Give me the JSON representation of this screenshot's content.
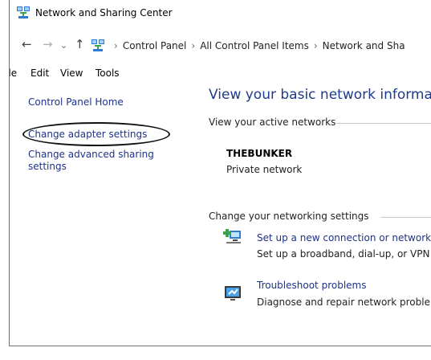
{
  "window": {
    "title": "Network and Sharing Center",
    "icon": "network-sharing-icon"
  },
  "navbar": {
    "back": "←",
    "forward": "→",
    "recent": "⌄",
    "up": "↑",
    "breadcrumb": [
      "Control Panel",
      "All Control Panel Items",
      "Network and Sha"
    ],
    "separator": "›"
  },
  "menubar": {
    "items": [
      "File",
      "Edit",
      "View",
      "Tools"
    ]
  },
  "sidebar": {
    "home": "Control Panel Home",
    "adapter": "Change adapter settings",
    "advanced": "Change advanced sharing settings"
  },
  "main": {
    "heading": "View your basic network informatio",
    "active_label": "View your active networks",
    "network_name": "THEBUNKER",
    "network_type": "Private network",
    "change_label": "Change your networking settings",
    "tasks": [
      {
        "link": "Set up a new connection or network",
        "desc": "Set up a broadband, dial-up, or VPN c",
        "icon": "new-connection-icon"
      },
      {
        "link": "Troubleshoot problems",
        "desc": "Diagnose and repair network problem",
        "icon": "troubleshoot-icon"
      }
    ]
  },
  "colors": {
    "link": "#1e3287",
    "heading": "#1e3a8a",
    "annotation": "#111111"
  }
}
